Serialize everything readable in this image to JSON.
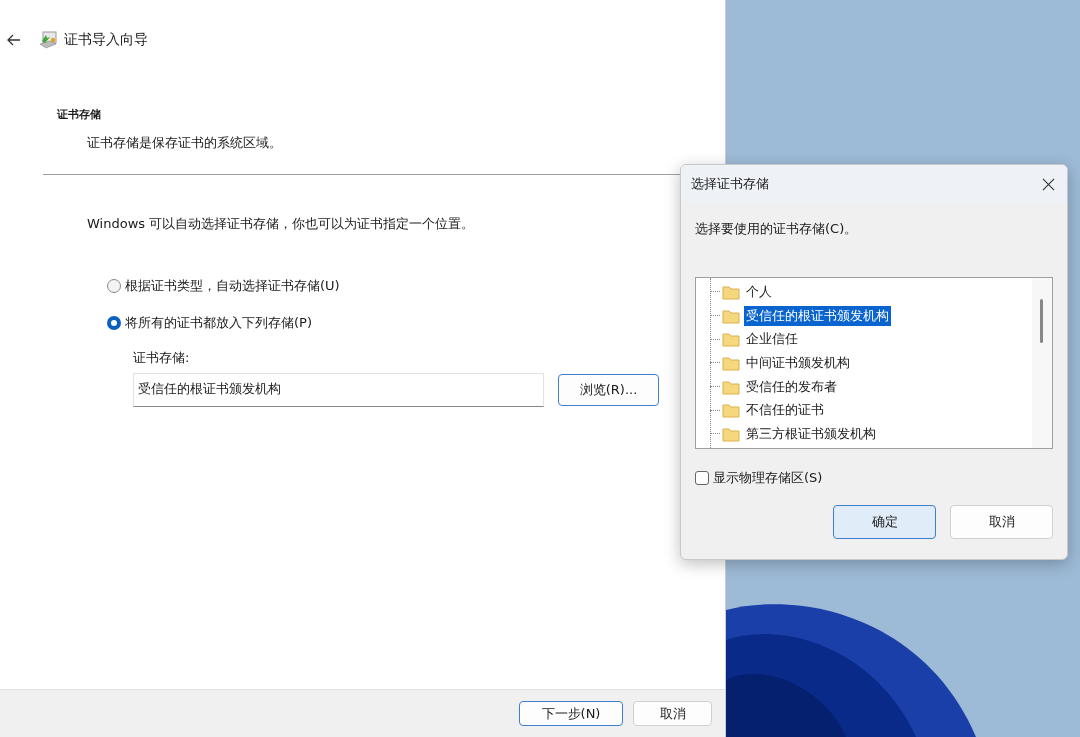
{
  "wizard": {
    "title": "证书导入向导",
    "heading": "证书存储",
    "subheading": "证书存储是保存证书的系统区域。",
    "description": "Windows 可以自动选择证书存储，你也可以为证书指定一个位置。",
    "options": [
      {
        "label": "根据证书类型，自动选择证书存储(U)",
        "selected": false
      },
      {
        "label": "将所有的证书都放入下列存储(P)",
        "selected": true
      }
    ],
    "store_label": "证书存储:",
    "store_value": "受信任的根证书颁发机构",
    "browse_button": "浏览(R)...",
    "buttons": [
      {
        "label": "下一步(N)",
        "default": true
      },
      {
        "label": "取消",
        "default": false
      }
    ]
  },
  "dialog": {
    "title": "选择证书存储",
    "prompt": "选择要使用的证书存储(C)。",
    "tree": [
      {
        "label": "个人",
        "selected": false
      },
      {
        "label": "受信任的根证书颁发机构",
        "selected": true
      },
      {
        "label": "企业信任",
        "selected": false
      },
      {
        "label": "中间证书颁发机构",
        "selected": false
      },
      {
        "label": "受信任的发布者",
        "selected": false
      },
      {
        "label": "不信任的证书",
        "selected": false
      },
      {
        "label": "第三方根证书颁发机构",
        "selected": false
      }
    ],
    "checkbox": {
      "label": "显示物理存储区(S)",
      "checked": false
    },
    "buttons": [
      {
        "label": "确定",
        "default": true
      },
      {
        "label": "取消",
        "default": false
      }
    ]
  }
}
